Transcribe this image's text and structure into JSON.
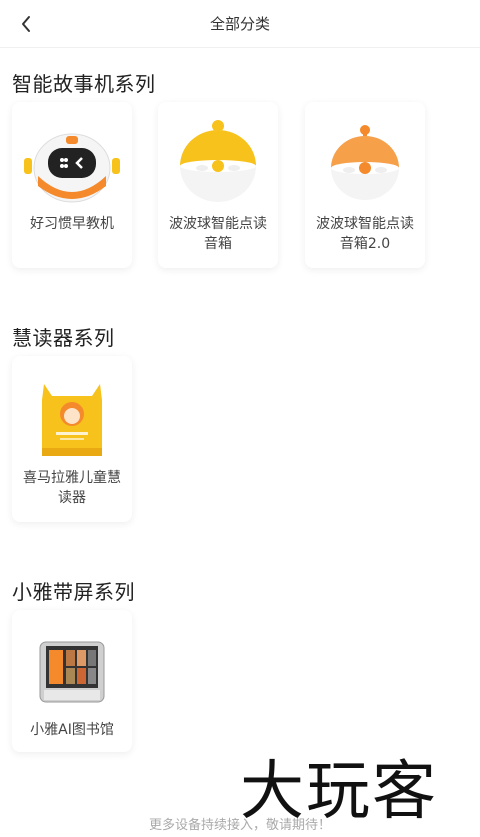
{
  "header": {
    "title": "全部分类",
    "back_icon": "chevron-left-icon"
  },
  "sections": [
    {
      "title": "智能故事机系列",
      "items": [
        {
          "label": "好习惯早教机",
          "image": "robot-device-image"
        },
        {
          "label": "波波球智能点读音箱",
          "image": "yellow-ball-speaker-image"
        },
        {
          "label": "波波球智能点读音箱2.0",
          "image": "orange-ball-speaker-image"
        }
      ]
    },
    {
      "title": "慧读器系列",
      "items": [
        {
          "label": "喜马拉雅儿童慧读器",
          "image": "yellow-cat-reader-image"
        }
      ]
    },
    {
      "title": "小雅带屏系列",
      "items": [
        {
          "label": "小雅AI图书馆",
          "image": "screen-device-image"
        }
      ]
    }
  ],
  "footer": {
    "text": "更多设备持续接入，敬请期待！"
  },
  "watermark": {
    "text": "大玩客"
  },
  "colors": {
    "accent_yellow": "#f7c21b",
    "accent_orange": "#f48a2b",
    "text": "#333333"
  }
}
